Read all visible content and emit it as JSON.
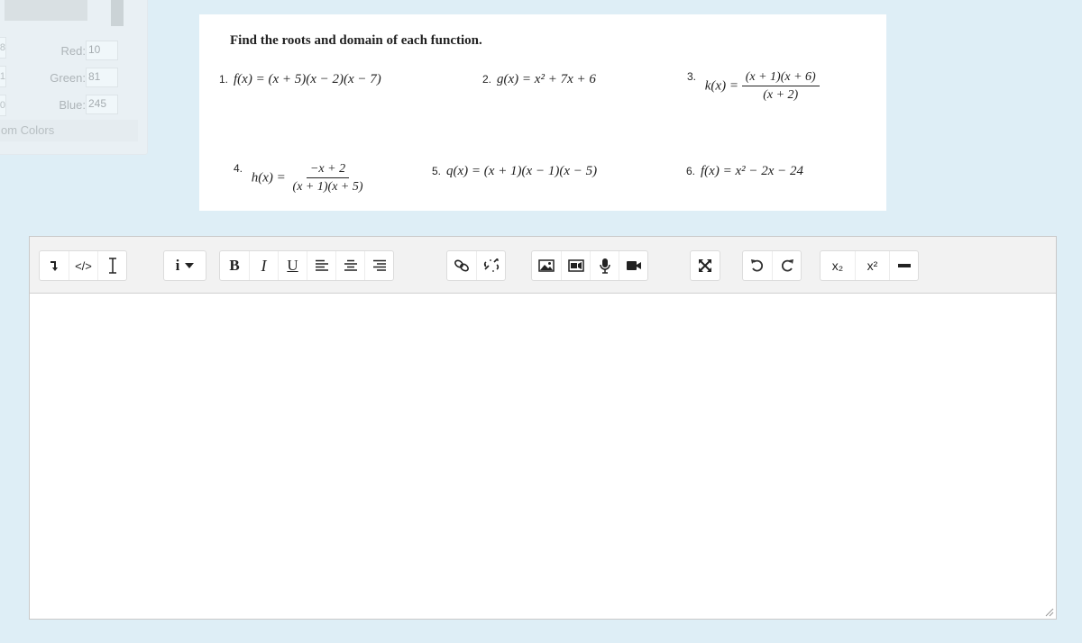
{
  "color_picker": {
    "left_values": [
      "8",
      "1",
      "0"
    ],
    "rows": [
      {
        "label": "Red:",
        "value": "10"
      },
      {
        "label": "Green:",
        "value": "81"
      },
      {
        "label": "Blue:",
        "value": "245"
      }
    ],
    "custom_label": "om Colors"
  },
  "question": {
    "title": "Find the roots  and domain of each function.",
    "p1": {
      "num": "1.",
      "expr": "f(x) = (x + 5)(x − 2)(x − 7)"
    },
    "p2": {
      "num": "2.",
      "expr": "g(x) = x² + 7x + 6"
    },
    "p3": {
      "num": "3.",
      "lhs": "k(x) =",
      "numerator": "(x + 1)(x + 6)",
      "denominator": "(x + 2)"
    },
    "p4": {
      "num": "4.",
      "lhs": "h(x) =",
      "numerator": "−x + 2",
      "denominator": "(x + 1)(x + 5)"
    },
    "p5": {
      "num": "5.",
      "expr": "q(x) = (x + 1)(x − 1)(x − 5)"
    },
    "p6": {
      "num": "6.",
      "expr": "f(x) = x² − 2x − 24"
    }
  },
  "toolbar": {
    "html_label": "</>",
    "bold_label": "B",
    "italic_label": "I",
    "underline_label": "U",
    "info_label": "i",
    "subscript_label": "x₂",
    "superscript_label": "x²"
  },
  "editor": {
    "content": ""
  }
}
